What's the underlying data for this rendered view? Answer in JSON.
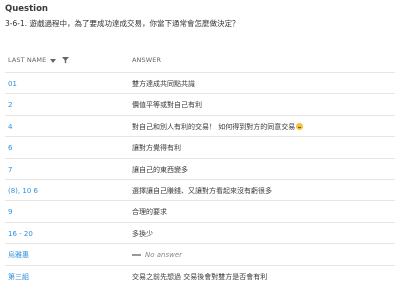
{
  "question": {
    "title": "Question",
    "text": "3-6-1. 遊戲過程中，為了要成功達成交易，你當下通常會怎麼做決定？"
  },
  "table": {
    "columns": {
      "name": "LAST NAME",
      "answer": "ANSWER"
    },
    "rows": [
      {
        "name": "01",
        "answer": "雙方達成共同點共識"
      },
      {
        "name": "2",
        "answer": "價值平等或對自己有利"
      },
      {
        "name": "4",
        "answer": "對自己和別人有利的交易！ 如何得到對方的同意交易"
      },
      {
        "name": "6",
        "answer": "讓對方覺得有利"
      },
      {
        "name": "7",
        "answer": "讓自己的東西變多"
      },
      {
        "name": "(8), 10 6",
        "answer": "選擇讓自己賺錢、又讓對方看起來沒有虧很多"
      },
      {
        "name": "9",
        "answer": "合理的要求"
      },
      {
        "name": "16 - 20",
        "answer": "多換少"
      },
      {
        "name": "烏雅惠",
        "answer": "No answer"
      },
      {
        "name": "第三組",
        "answer": "交易之前先想過 交易後會對雙方是否會有利"
      }
    ]
  },
  "colors": {
    "link": "#2f8fdb",
    "text": "#333333",
    "divider": "#e6e6e6"
  },
  "icons": {
    "sort": "caret-down-icon",
    "filter": "filter-icon",
    "emoji": "grinning-face-icon",
    "no_answer": "dash-icon"
  }
}
